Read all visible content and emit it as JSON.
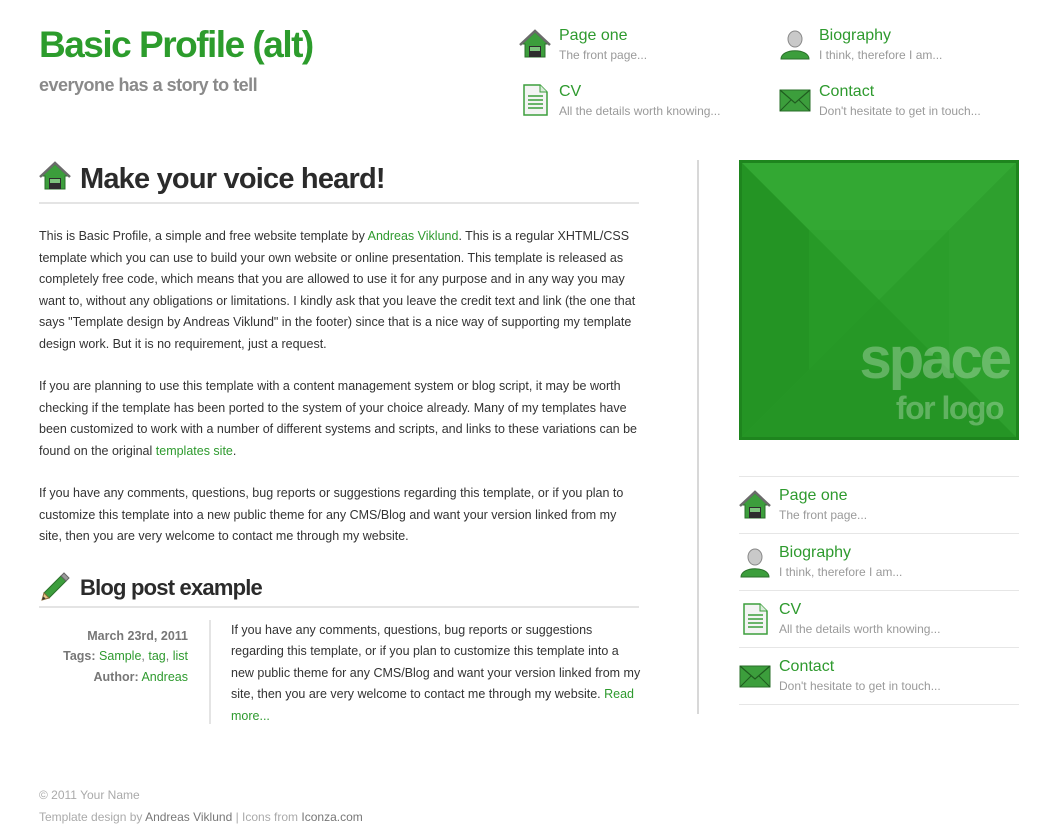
{
  "header": {
    "title": "Basic Profile (alt)",
    "tagline": "everyone has a story to tell"
  },
  "nav": [
    {
      "title": "Page one",
      "desc": "The front page...",
      "icon": "home-icon"
    },
    {
      "title": "Biography",
      "desc": "I think, therefore I am...",
      "icon": "user-icon"
    },
    {
      "title": "CV",
      "desc": "All the details worth knowing...",
      "icon": "document-icon"
    },
    {
      "title": "Contact",
      "desc": "Don't hesitate to get in touch...",
      "icon": "envelope-icon"
    }
  ],
  "main": {
    "heading": "Make your voice heard!",
    "p1_before": "This is Basic Profile, a simple and free website template by ",
    "p1_link": "Andreas Viklund",
    "p1_after": ". This is a regular XHTML/CSS template which you can use to build your own website or online presentation. This template is released as completely free code, which means that you are allowed to use it for any purpose and in any way you may want to, without any obligations or limitations. I kindly ask that you leave the credit text and link (the one that says \"Template design by Andreas Viklund\" in the footer) since that is a nice way of supporting my template design work. But it is no requirement, just a request.",
    "p2_before": "If you are planning to use this template with a content management system or blog script, it may be worth checking if the template has been ported to the system of your choice already. Many of my templates have been customized to work with a number of different systems and scripts, and links to these variations can be found on the original ",
    "p2_link": "templates site",
    "p2_after": ".",
    "p3": "If you have any comments, questions, bug reports or suggestions regarding this template, or if you plan to customize this template into a new public theme for any CMS/Blog and want your version linked from my site, then you are very welcome to contact me through my website."
  },
  "blog": {
    "heading": "Blog post example",
    "date": "March 23rd, 2011",
    "tags_label": "Tags:",
    "tags": [
      "Sample",
      "tag",
      "list"
    ],
    "author_label": "Author:",
    "author": "Andreas",
    "text": "If you have any comments, questions, bug reports or suggestions regarding this template, or if you plan to customize this template into a new public theme for any CMS/Blog and want your version linked from my site, then you are very welcome to contact me through my website. ",
    "read_more": "Read more..."
  },
  "sidebar": {
    "logo_line1": "space",
    "logo_line2": "for logo"
  },
  "footer": {
    "copyright": "© 2011 Your Name",
    "design_prefix": "Template design by ",
    "designer": "Andreas Viklund",
    "separator": " | Icons from ",
    "icons_source": "Iconza.com"
  },
  "colors": {
    "accent": "#2e9a2e",
    "logo_bg": "#2a9e2a",
    "text": "#333333",
    "muted": "#9a9a9a"
  }
}
